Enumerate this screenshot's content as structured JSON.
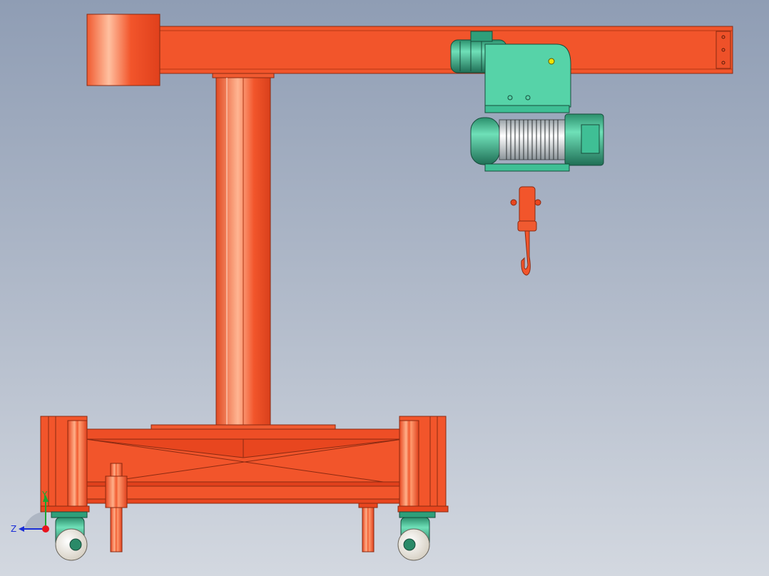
{
  "viewport": {
    "model": "jib-crane-with-electric-hoist",
    "background_colors": [
      "#8f9db4",
      "#d3d8e0"
    ]
  },
  "colors": {
    "frame": "#f2502a",
    "frame_dark": "#c8361a",
    "frame_light": "#ff9a6e",
    "hoist": "#3fbf95",
    "hoist_dark": "#1f6e55",
    "drum": "#e8ecef",
    "caster_wheel": "#f4f0e8"
  },
  "triad": {
    "x_color": "#e8131d",
    "y_label": "Y",
    "z_label": "Z",
    "y_color": "#1aa632",
    "z_color": "#1a2ed6"
  }
}
